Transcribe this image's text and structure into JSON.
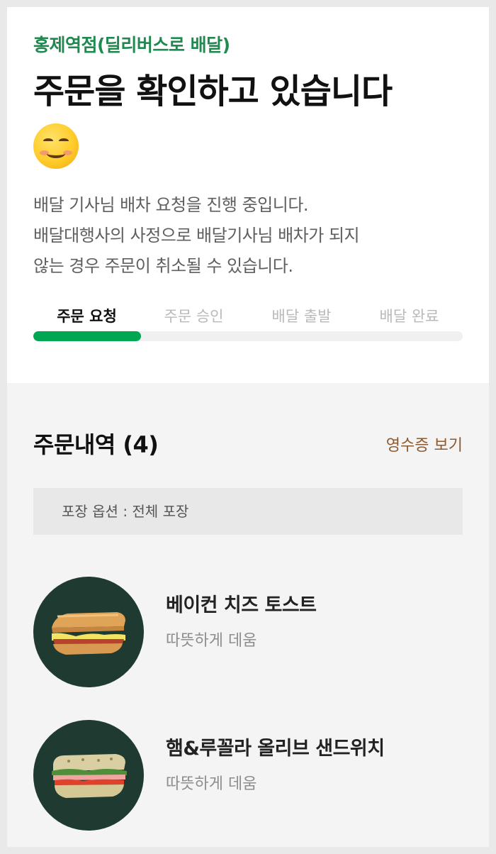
{
  "store": {
    "name": "홍제역점(딜리버스로 배달)"
  },
  "status": {
    "headline": "주문을 확인하고 있습니다",
    "emoji_icon": "smiling-face-icon",
    "description_lines": [
      "배달 기사님 배차 요청을 진행 중입니다.",
      "배달대행사의 사정으로 배달기사님 배차가 되지",
      "않는 경우 주문이 취소될 수 있습니다."
    ]
  },
  "progress": {
    "steps": [
      "주문 요청",
      "주문 승인",
      "배달 출발",
      "배달 완료"
    ],
    "active_index": 0,
    "fill_fraction": 0.25,
    "accent_color": "#00a651"
  },
  "order": {
    "title": "주문내역 (4)",
    "receipt_link": "영수증 보기",
    "packaging_option": "포장 옵션 : 전체 포장",
    "items": [
      {
        "name": "베이컨 치즈 토스트",
        "option": "따뜻하게 데움",
        "image": "toast-sandwich-image"
      },
      {
        "name": "햄&루꼴라 올리브 샌드위치",
        "option": "따뜻하게 데움",
        "image": "ciabatta-sandwich-image"
      }
    ]
  },
  "colors": {
    "store_name": "#1f8a4f",
    "receipt_link": "#8a5a32",
    "item_bg": "#1f3a30"
  }
}
